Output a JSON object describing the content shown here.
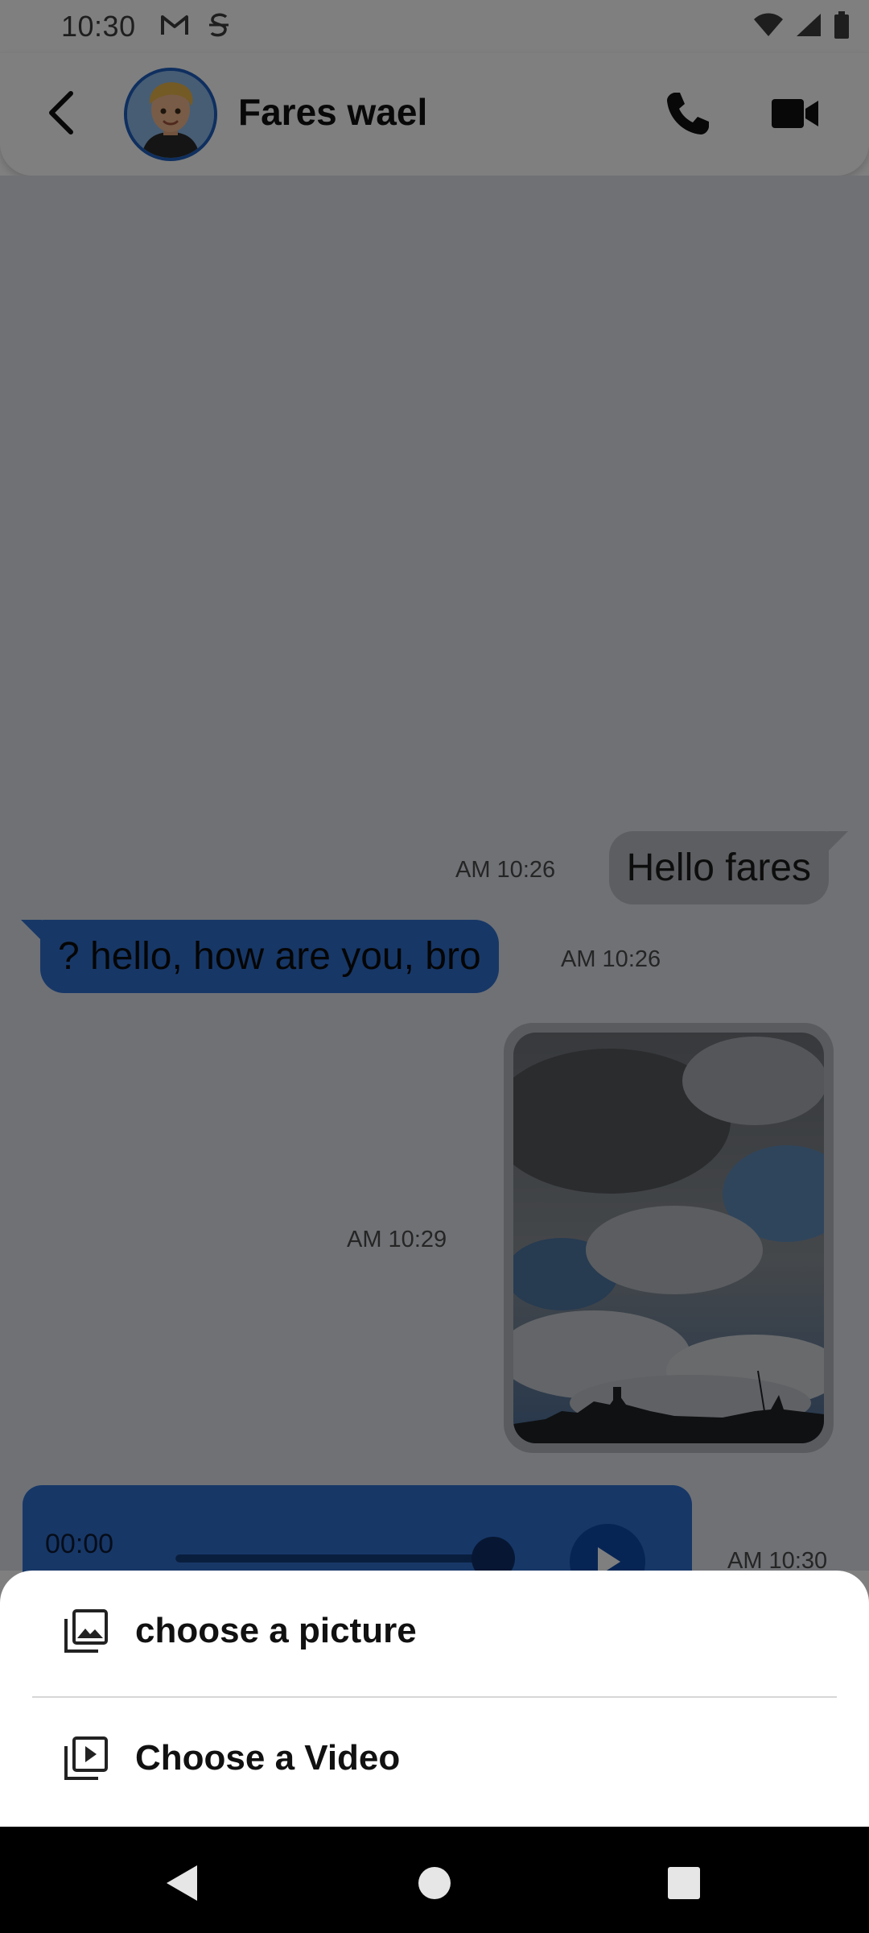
{
  "status_bar": {
    "time": "10:30",
    "notification_icons": [
      "gmail-icon",
      "s-app-icon"
    ],
    "system_icons": [
      "wifi-icon",
      "signal-icon",
      "battery-icon"
    ]
  },
  "header": {
    "contact_name": "Fares wael",
    "avatar": "avatar-memoji",
    "back_icon": "chevron-left-icon",
    "call_icon": "phone-icon",
    "video_icon": "video-camera-icon"
  },
  "messages": [
    {
      "direction": "outgoing",
      "type": "text",
      "text": "Hello fares",
      "time": "AM 10:26"
    },
    {
      "direction": "incoming",
      "type": "text",
      "text": "? hello, how are you, bro",
      "time": "AM 10:26"
    },
    {
      "direction": "outgoing",
      "type": "image",
      "time": "AM 10:29"
    },
    {
      "direction": "incoming",
      "type": "audio",
      "duration": "00:00",
      "progress": 0.9,
      "time": "AM 10:30"
    }
  ],
  "bottom_sheet": {
    "items": [
      {
        "label": "choose a picture",
        "icon": "image-gallery-icon"
      },
      {
        "label": "Choose a Video",
        "icon": "video-library-icon"
      }
    ]
  },
  "colors": {
    "accent": "#2f6fcf",
    "outgoing_bubble": "#b9bcc2",
    "chat_background": "#dfe3ea",
    "scrim": "rgba(0,0,0,0.5)"
  },
  "nav_bar": {
    "icons": [
      "nav-back-icon",
      "nav-home-icon",
      "nav-recents-icon"
    ]
  }
}
